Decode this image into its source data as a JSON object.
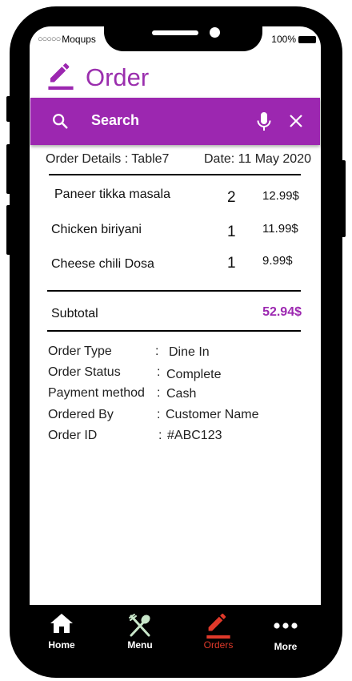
{
  "status_bar": {
    "carrier_dots": "○○○○○",
    "carrier": "Moqups",
    "battery": "100%"
  },
  "header": {
    "title": "Order"
  },
  "search": {
    "label": "Search"
  },
  "order_details": {
    "label": "Order Details : Table7",
    "date": "Date: 11 May 2020"
  },
  "items": [
    {
      "name": "Paneer tikka masala",
      "qty": "2",
      "price": "12.99$"
    },
    {
      "name": "Chicken biriyani",
      "qty": "1",
      "price": "11.99$"
    },
    {
      "name": "Cheese chili Dosa",
      "qty": "1",
      "price": "9.99$"
    }
  ],
  "subtotal": {
    "label": "Subtotal",
    "value": "52.94$"
  },
  "info": {
    "order_type": {
      "label": "Order Type",
      "value": "Dine In"
    },
    "order_status": {
      "label": "Order Status",
      "value": "Complete"
    },
    "payment_method": {
      "label": "Payment method",
      "value": "Cash"
    },
    "ordered_by": {
      "label": "Ordered By",
      "value": "Customer Name"
    },
    "order_id": {
      "label": "Order ID",
      "value": "#ABC123"
    },
    "separator": ":"
  },
  "nav": {
    "home": "Home",
    "menu": "Menu",
    "orders": "Orders",
    "more": "More",
    "active": "orders"
  },
  "colors": {
    "accent": "#9c27b0",
    "active_nav": "#e0392a",
    "menu_icon": "#c8e6c9"
  },
  "icons": {
    "title": "edit-icon",
    "search": "search-icon",
    "mic": "mic-icon",
    "clear": "close-icon",
    "home": "home-icon",
    "menu": "fork-spoon-icon",
    "orders": "edit-icon",
    "more": "more-dots-icon"
  }
}
